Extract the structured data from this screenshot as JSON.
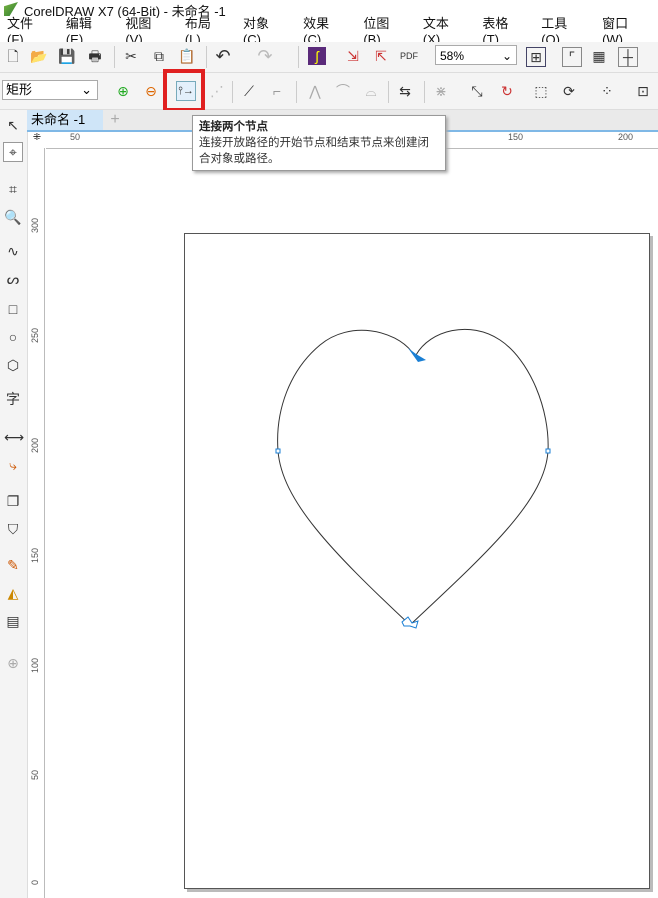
{
  "window": {
    "title": "CorelDRAW X7 (64-Bit) - 未命名 -1"
  },
  "menu": [
    "文件(F)",
    "编辑(E)",
    "视图(V)",
    "布局(L)",
    "对象(C)",
    "效果(C)",
    "位图(B)",
    "文本(X)",
    "表格(T)",
    "工具(O)",
    "窗口(W)"
  ],
  "toolbar": {
    "zoom_value": "58%",
    "icons": [
      "new-icon",
      "open-icon",
      "save-icon",
      "print-icon",
      "cut-icon",
      "copy-icon",
      "paste-icon",
      "undo-icon",
      "redo-icon",
      "corel-connect-icon",
      "import-icon",
      "export-icon",
      "pdf-icon"
    ]
  },
  "property_bar": {
    "shape_select": "矩形",
    "selected_tool": "join-two-nodes"
  },
  "document": {
    "tab": "未命名 -1",
    "add_tab": "+"
  },
  "tooltip": {
    "title": "连接两个节点",
    "body": "连接开放路径的开始节点和结束节点来创建闭合对象或路径。"
  },
  "ruler": {
    "h_labels": [
      "50",
      "150",
      "200"
    ],
    "v_labels": [
      "300",
      "250",
      "200",
      "150",
      "100",
      "50",
      "0"
    ]
  },
  "colors": {
    "highlight": "#e02020",
    "node": "#1a7fd4",
    "tab_accent": "#7fb8e6"
  }
}
